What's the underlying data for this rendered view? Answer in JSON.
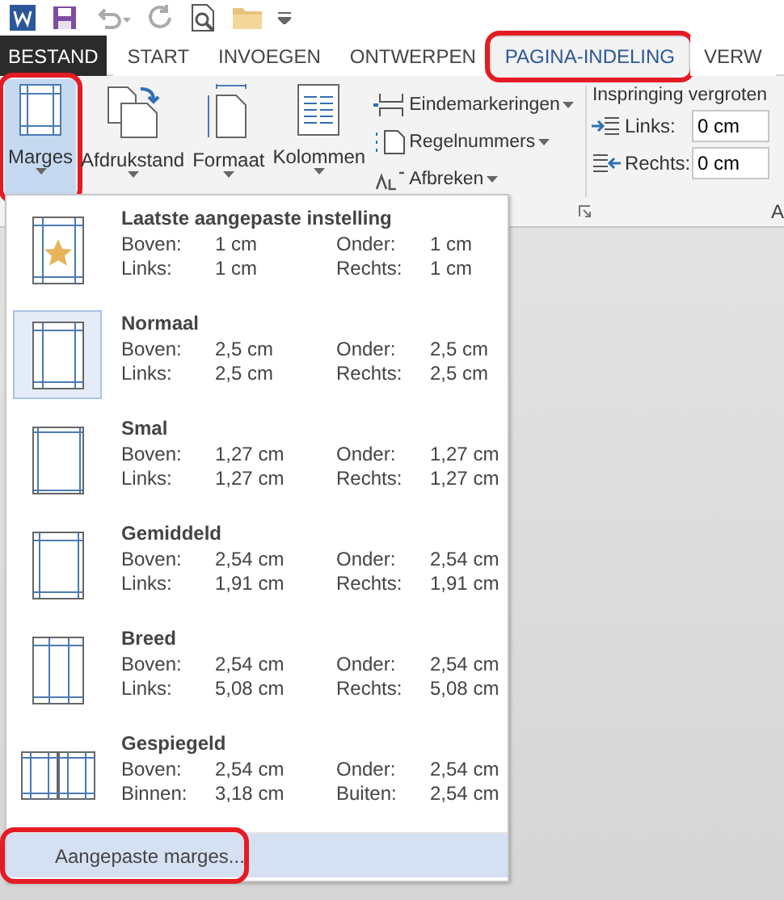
{
  "tabs": [
    {
      "label": "BESTAND",
      "kind": "file",
      "selected": false,
      "highlighted": false
    },
    {
      "label": "START",
      "kind": "tab",
      "selected": false,
      "highlighted": false
    },
    {
      "label": "INVOEGEN",
      "kind": "tab",
      "selected": false,
      "highlighted": false
    },
    {
      "label": "ONTWERPEN",
      "kind": "tab",
      "selected": false,
      "highlighted": false
    },
    {
      "label": "PAGINA-INDELING",
      "kind": "tab",
      "selected": true,
      "highlighted": true
    },
    {
      "label": "VERW",
      "kind": "tab",
      "selected": false,
      "highlighted": false
    }
  ],
  "ribbon": {
    "large_buttons": [
      {
        "label": "Marges",
        "selected": true,
        "highlighted": true
      },
      {
        "label": "Afdrukstand",
        "selected": false,
        "highlighted": false
      },
      {
        "label": "Formaat",
        "selected": false,
        "highlighted": false
      },
      {
        "label": "Kolommen",
        "selected": false,
        "highlighted": false
      }
    ],
    "small_buttons": [
      {
        "label": "Eindemarkeringen"
      },
      {
        "label": "Regelnummers"
      },
      {
        "label": "Afbreken"
      }
    ],
    "indent": {
      "title": "Inspringing vergroten",
      "fields": [
        {
          "label": "Links:",
          "value": "0 cm"
        },
        {
          "label": "Rechts:",
          "value": "0 cm"
        }
      ]
    },
    "group_label": "A"
  },
  "margins_menu": {
    "presets": [
      {
        "name": "Laatste aangepaste instelling",
        "selected": false,
        "rows": [
          {
            "label": "Boven:",
            "value": "1 cm",
            "label2": "Onder:",
            "value2": "1 cm"
          },
          {
            "label": "Links:",
            "value": "1 cm",
            "label2": "Rechts:",
            "value2": "1 cm"
          }
        ]
      },
      {
        "name": "Normaal",
        "selected": true,
        "rows": [
          {
            "label": "Boven:",
            "value": "2,5 cm",
            "label2": "Onder:",
            "value2": "2,5 cm"
          },
          {
            "label": "Links:",
            "value": "2,5 cm",
            "label2": "Rechts:",
            "value2": "2,5 cm"
          }
        ]
      },
      {
        "name": "Smal",
        "selected": false,
        "rows": [
          {
            "label": "Boven:",
            "value": "1,27 cm",
            "label2": "Onder:",
            "value2": "1,27 cm"
          },
          {
            "label": "Links:",
            "value": "1,27 cm",
            "label2": "Rechts:",
            "value2": "1,27 cm"
          }
        ]
      },
      {
        "name": "Gemiddeld",
        "selected": false,
        "rows": [
          {
            "label": "Boven:",
            "value": "2,54 cm",
            "label2": "Onder:",
            "value2": "2,54 cm"
          },
          {
            "label": "Links:",
            "value": "1,91 cm",
            "label2": "Rechts:",
            "value2": "1,91 cm"
          }
        ]
      },
      {
        "name": "Breed",
        "selected": false,
        "rows": [
          {
            "label": "Boven:",
            "value": "2,54 cm",
            "label2": "Onder:",
            "value2": "2,54 cm"
          },
          {
            "label": "Links:",
            "value": "5,08 cm",
            "label2": "Rechts:",
            "value2": "5,08 cm"
          }
        ]
      },
      {
        "name": "Gespiegeld",
        "selected": false,
        "rows": [
          {
            "label": "Boven:",
            "value": "2,54 cm",
            "label2": "Onder:",
            "value2": "2,54 cm"
          },
          {
            "label": "Binnen:",
            "value": "3,18 cm",
            "label2": "Buiten:",
            "value2": "2,54 cm"
          }
        ]
      }
    ],
    "custom_item": {
      "label": "Aangepaste marges...",
      "highlighted": true
    }
  }
}
